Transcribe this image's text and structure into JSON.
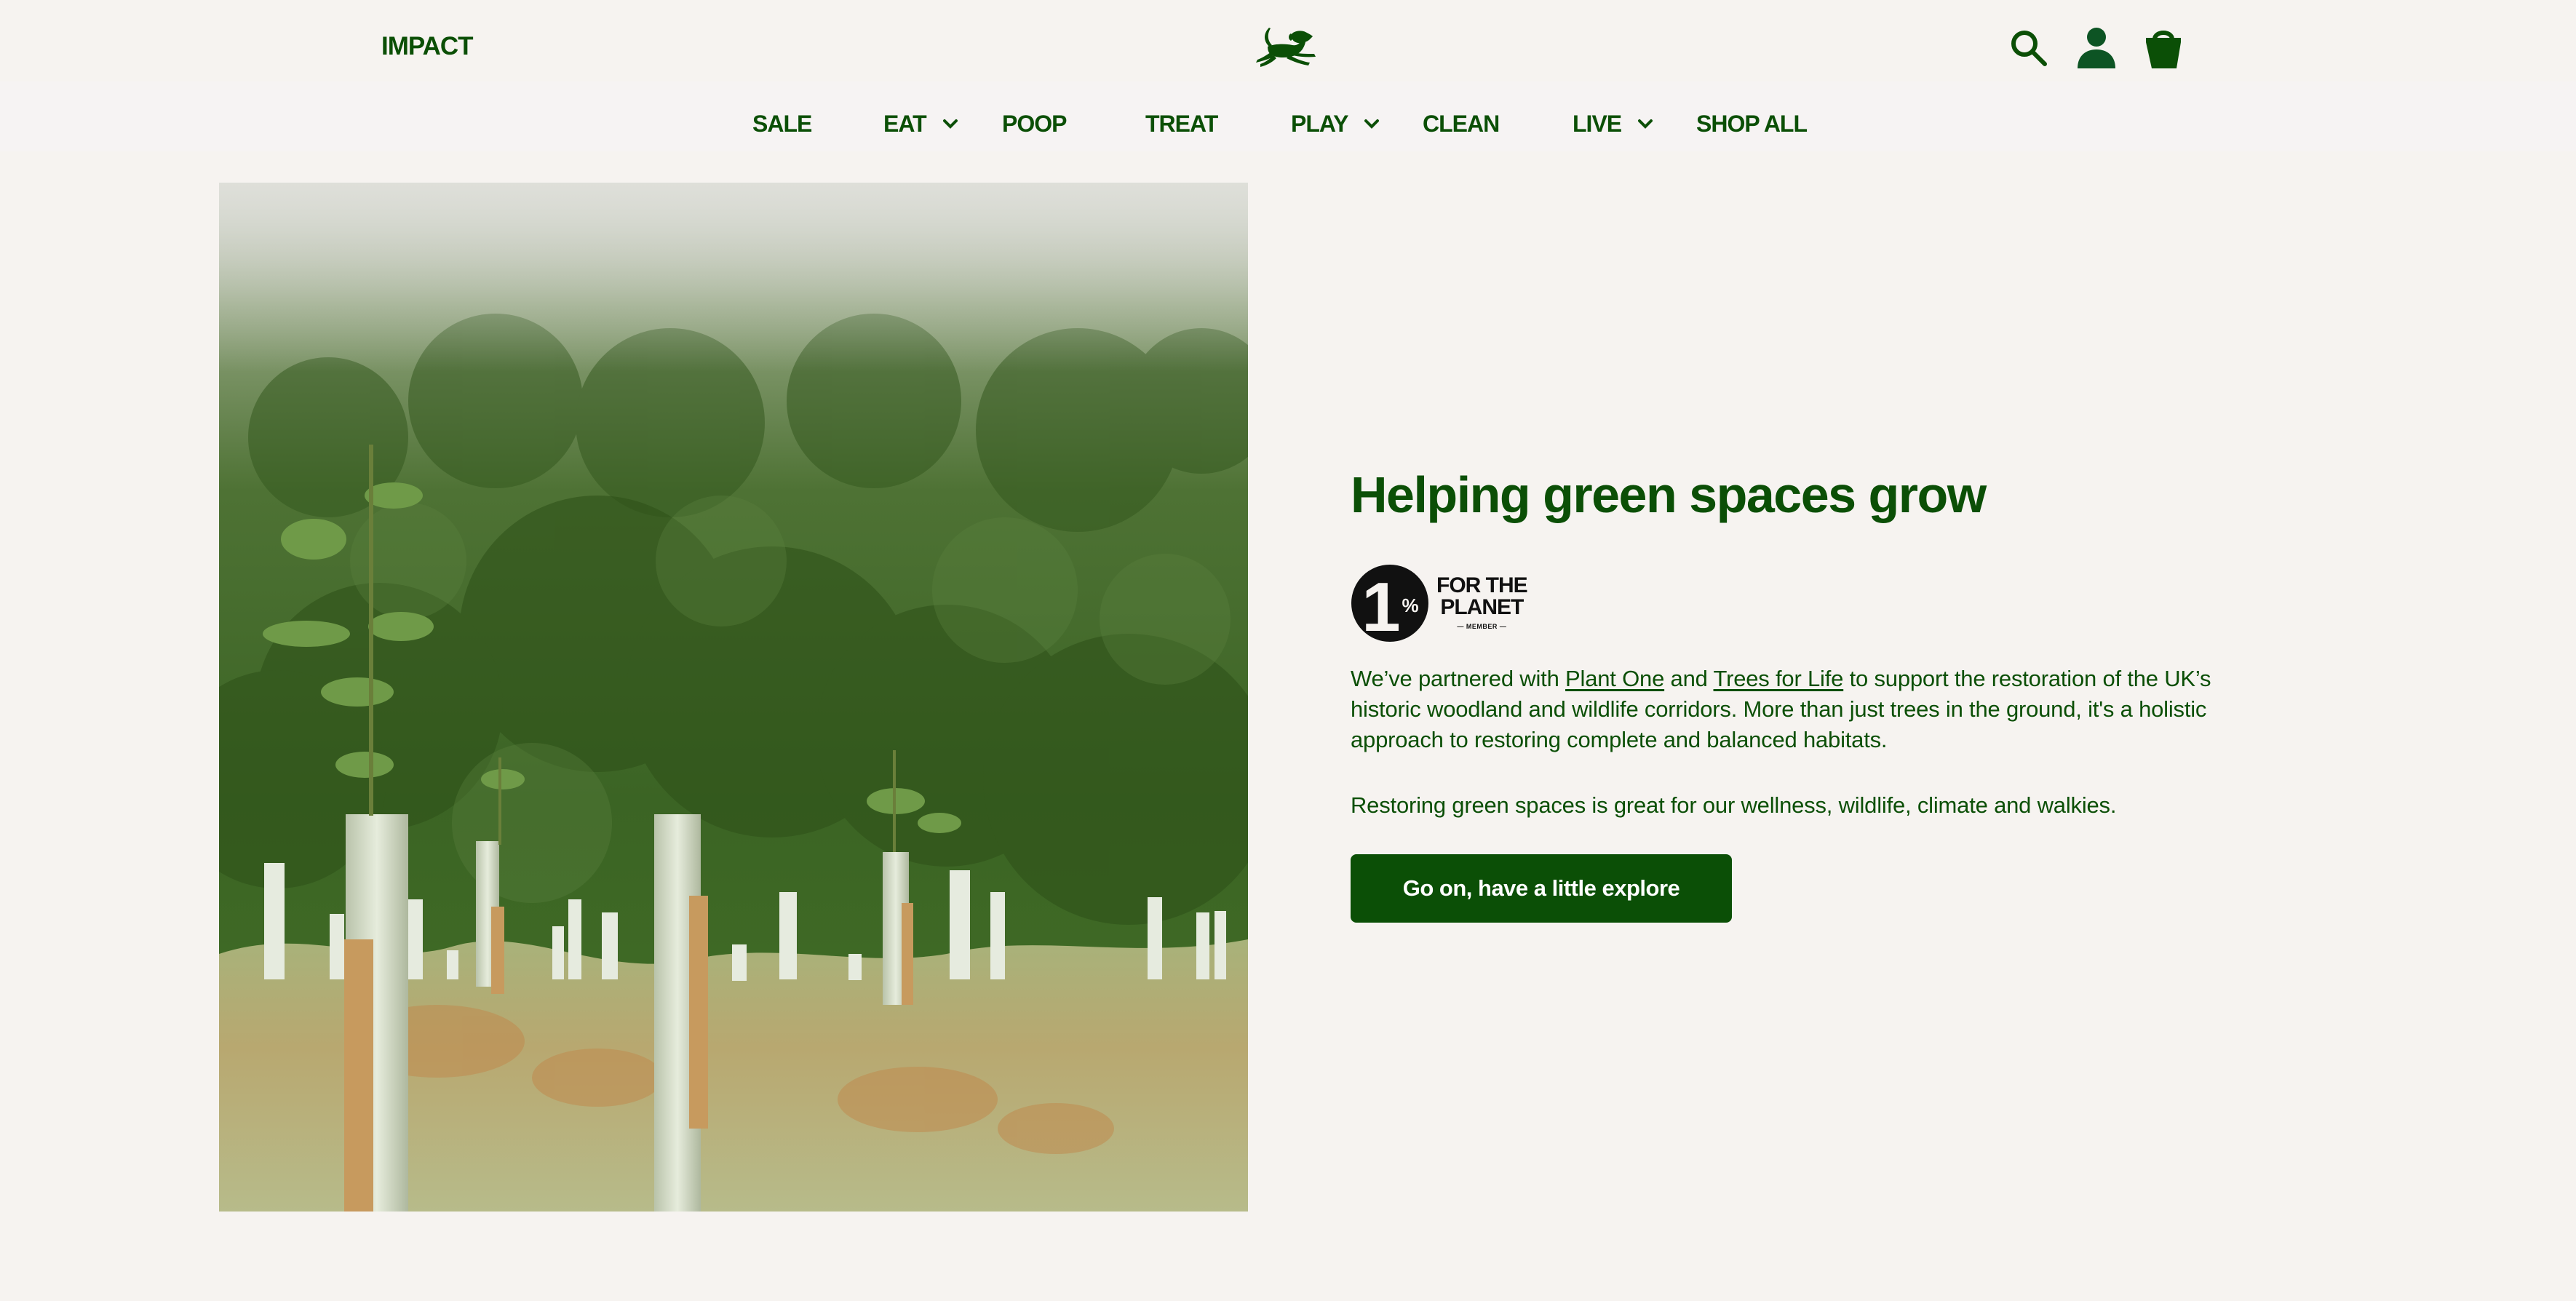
{
  "header": {
    "impact_link": "IMPACT",
    "logo_alt": "running-dog-logo",
    "icons": [
      "search-icon",
      "account-icon",
      "basket-icon"
    ]
  },
  "nav": {
    "items": [
      {
        "label": "SALE",
        "has_dropdown": false
      },
      {
        "label": "EAT",
        "has_dropdown": true
      },
      {
        "label": "POOP",
        "has_dropdown": false
      },
      {
        "label": "TREAT",
        "has_dropdown": false
      },
      {
        "label": "PLAY",
        "has_dropdown": true
      },
      {
        "label": "CLEAN",
        "has_dropdown": false
      },
      {
        "label": "LIVE",
        "has_dropdown": true
      },
      {
        "label": "SHOP ALL",
        "has_dropdown": false
      }
    ]
  },
  "main": {
    "title": "Helping green spaces grow",
    "badge": {
      "number": "1",
      "percent": "%",
      "line1": "FOR THE",
      "line2": "PLANET",
      "line3": "— MEMBER —"
    },
    "paragraph1": {
      "pre": "We’ve partnered with ",
      "link1": "Plant One",
      "mid": " and ",
      "link2": "Trees for Life",
      "post": " to support the restoration of the UK’s historic woodland and wildlife corridors. More than just trees in the ground, it's a holistic approach to restoring complete and balanced habitats."
    },
    "paragraph2": "Restoring green spaces is great for our wellness, wildlife, climate and walkies.",
    "cta_label": "Go on, have a little explore",
    "image_alt": "Young saplings in tree guards among ferns in front of a misty forested hillside"
  },
  "colors": {
    "brand_green": "#0b4f06",
    "background": "#f6f3f0",
    "nav_band": "#f6f3f3",
    "button_text": "#ffffff"
  }
}
